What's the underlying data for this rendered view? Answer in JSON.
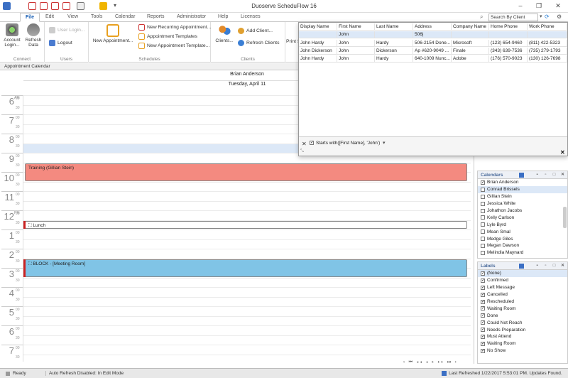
{
  "window": {
    "title": "Duoserve ScheduFlow 16",
    "minimize": "–",
    "restore": "❐",
    "close": "✕"
  },
  "tabs": [
    "File",
    "Edit",
    "View",
    "Tools",
    "Calendar",
    "Reports",
    "Administrator",
    "Help",
    "Licenses"
  ],
  "search": {
    "value": "Search By Client"
  },
  "ribbon": {
    "connect": {
      "label": "Connect",
      "account": "Account\nLogin...",
      "refresh": "Refresh\nData"
    },
    "users": {
      "label": "Users",
      "user_login": "User Login...",
      "logout": "Logout"
    },
    "schedules": {
      "label": "Schedules",
      "new_appointment": "New Appointment...",
      "new_recurring": "New Recurring Appointment...",
      "appt_templates": "Appointment Templates",
      "new_appt_template": "New Appointment Template..."
    },
    "clients": {
      "label": "Clients",
      "clients": "Clients...",
      "add_client": "Add Client...",
      "refresh_clients": "Refresh Clients"
    },
    "print": "Print S"
  },
  "section_title": "Appointment Calendar",
  "calendar": {
    "resource": "Brian Anderson",
    "date": "Tuesday, April 11",
    "hours": [
      {
        "n": "6",
        "ap": "AM"
      },
      {
        "n": "7",
        "ap": ""
      },
      {
        "n": "8",
        "ap": ""
      },
      {
        "n": "9",
        "ap": ""
      },
      {
        "n": "10",
        "ap": ""
      },
      {
        "n": "11",
        "ap": ""
      },
      {
        "n": "12",
        "ap": "PM"
      },
      {
        "n": "1",
        "ap": ""
      },
      {
        "n": "2",
        "ap": ""
      },
      {
        "n": "3",
        "ap": ""
      },
      {
        "n": "4",
        "ap": ""
      },
      {
        "n": "5",
        "ap": ""
      },
      {
        "n": "6",
        "ap": ""
      },
      {
        "n": "7",
        "ap": ""
      }
    ],
    "min_label": "30",
    "min_00": "00",
    "appointments": [
      {
        "title": "Training (Gillian Stein)",
        "color": "#f48a80",
        "start": "9:30",
        "end": "10:30"
      },
      {
        "title": "Lunch",
        "color": "#ffffff",
        "start": "12:30",
        "end": "1:00"
      },
      {
        "title": "BLOCK - [Meeting Room]",
        "color": "#80c4e6",
        "start": "2:30",
        "end": "3:30"
      }
    ],
    "nav": "‹ ⏮ ◂◂ ◂ ▸ ▸▸ ⏭ ›"
  },
  "client_grid": {
    "columns": [
      "Display Name",
      "First Name",
      "Last Name",
      "Address",
      "Company Name",
      "Home Phone",
      "Work Phone"
    ],
    "filter_row": [
      "",
      "John",
      "",
      "506|",
      "",
      "",
      ""
    ],
    "rows": [
      [
        "John Hardy",
        "John",
        "Hardy",
        "506-2154 Done...",
        "Microsoft",
        "(123) 654-9460",
        "(811) 422-5323"
      ],
      [
        "John Dickerson",
        "John",
        "Dickerson",
        "Ap #620-9049 ...",
        "Finale",
        "(343) 639-7536",
        "(735) 279-1793"
      ],
      [
        "John Hardy",
        "John",
        "Hardy",
        "640-1009 Nunc...",
        "Adobe",
        "(176) 570-9023",
        "(130) 126-7698"
      ]
    ],
    "filter_text": "Starts with([First Name], 'John')"
  },
  "calendars_panel": {
    "title": "Calendars",
    "items": [
      {
        "label": "Brian Anderson",
        "checked": true
      },
      {
        "label": "Conrad Brissels",
        "checked": false,
        "selected": true
      },
      {
        "label": "Gillian Stein",
        "checked": false
      },
      {
        "label": "Jessica White",
        "checked": false
      },
      {
        "label": "Johathon Jacobs",
        "checked": false
      },
      {
        "label": "Kelly Carlson",
        "checked": false
      },
      {
        "label": "Lyle Byrd",
        "checked": false
      },
      {
        "label": "Mean Smal",
        "checked": false
      },
      {
        "label": "Medge Giles",
        "checked": false
      },
      {
        "label": "Megan Dawson",
        "checked": false
      },
      {
        "label": "Melindia Maynard",
        "checked": false
      }
    ]
  },
  "labels_panel": {
    "title": "Labels",
    "items": [
      {
        "label": "(None)",
        "checked": true,
        "selected": true
      },
      {
        "label": "Confirmed",
        "checked": true
      },
      {
        "label": "Left Message",
        "checked": true
      },
      {
        "label": "Cancelled",
        "checked": true
      },
      {
        "label": "Rescheduled",
        "checked": true
      },
      {
        "label": "Waiting Room",
        "checked": true
      },
      {
        "label": "Done",
        "checked": true
      },
      {
        "label": "Could Not Reach",
        "checked": true
      },
      {
        "label": "Needs Preparation",
        "checked": true
      },
      {
        "label": "Must Attend",
        "checked": true
      },
      {
        "label": "Waiting Room",
        "checked": true
      },
      {
        "label": "No Show",
        "checked": true
      }
    ]
  },
  "status": {
    "ready": "Ready",
    "refresh": "Auto Refresh Disabled: In Edit Mode",
    "last_refreshed": "Last Refreshed 1/22/2017 5:53:01 PM. Updates Found."
  },
  "colors": {
    "accent": "#1a5fb4",
    "selection": "#dce8f7",
    "lunch_bar": "#cc2222"
  }
}
